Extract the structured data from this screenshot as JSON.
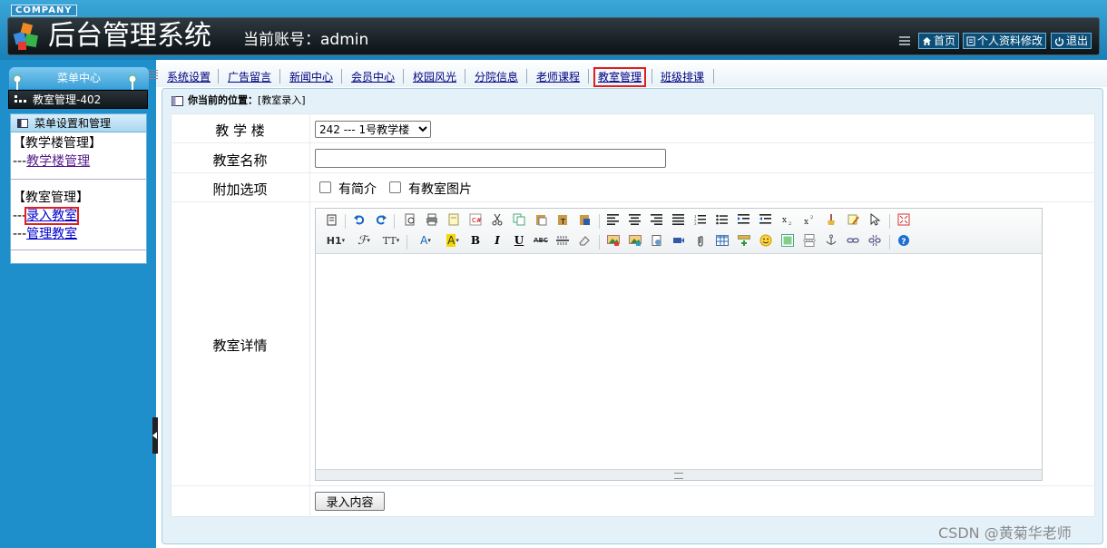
{
  "header": {
    "company": "COMPANY",
    "app_title": "后台管理系统",
    "account_label": "当前账号：",
    "account_value": "admin",
    "buttons": {
      "home": "首页",
      "profile": "个人资料修改",
      "logout": "退出"
    }
  },
  "sidebar": {
    "menu_center": "菜单中心",
    "room_title": "教室管理-402",
    "panel_title": "菜单设置和管理",
    "groups": [
      {
        "title": "【教学楼管理】",
        "links": [
          {
            "prefix": "---",
            "label": "教学楼管理"
          }
        ]
      },
      {
        "title": "【教室管理】",
        "links": [
          {
            "prefix": "---",
            "label": "录入教室"
          },
          {
            "prefix": "---",
            "label": "管理教室"
          }
        ]
      }
    ]
  },
  "nav": {
    "items": [
      "系统设置",
      "广告留言",
      "新闻中心",
      "会员中心",
      "校园风光",
      "分院信息",
      "老师课程",
      "教室管理",
      "班级排课"
    ],
    "active": "教室管理"
  },
  "breadcrumb": {
    "label": "你当前的位置：",
    "value": "[教室录入]"
  },
  "form": {
    "building_label": "教 学 楼",
    "building_selected": "242 --- 1号教学楼",
    "name_label": "教室名称",
    "name_value": "",
    "options_label": "附加选项",
    "option_intro": "有简介",
    "option_image": "有教室图片",
    "details_label": "教室详情",
    "submit": "录入内容"
  },
  "editor": {
    "row2_labels": {
      "heading": "H1",
      "font_family": "ℱ",
      "font_size": "TT",
      "font_color": "A",
      "bg_color": "A",
      "bold": "B",
      "italic": "I",
      "underline": "U",
      "strike": "ABC"
    }
  },
  "watermark": "CSDN @黄菊华老师",
  "colors": {
    "header_blue": "#1a7fb8",
    "sidebar_blue": "#1f8fcc",
    "highlight_red": "#e02020"
  }
}
